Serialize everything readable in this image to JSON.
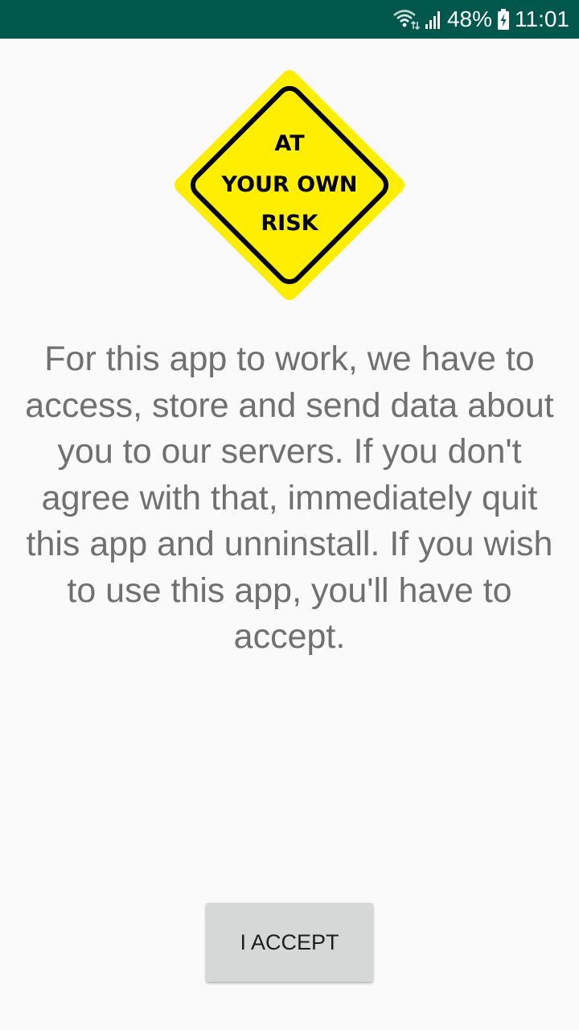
{
  "status_bar": {
    "battery_percent": "48%",
    "time": "11:01",
    "icons": [
      "wifi-icon",
      "signal-icon",
      "battery-charging-icon"
    ],
    "background_color": "#00574b"
  },
  "warning_sign": {
    "line1": "AT",
    "line2": "YOUR OWN",
    "line3": "RISK",
    "fill_color": "#ffee00",
    "border_color": "#000000"
  },
  "message": "For this app to work, we have to access, store and send data about you to our servers. If you don't agree with that, immediately quit this app and unninstall. If you wish to use this app, you'll have to accept.",
  "accept_button": {
    "label": "I ACCEPT"
  }
}
